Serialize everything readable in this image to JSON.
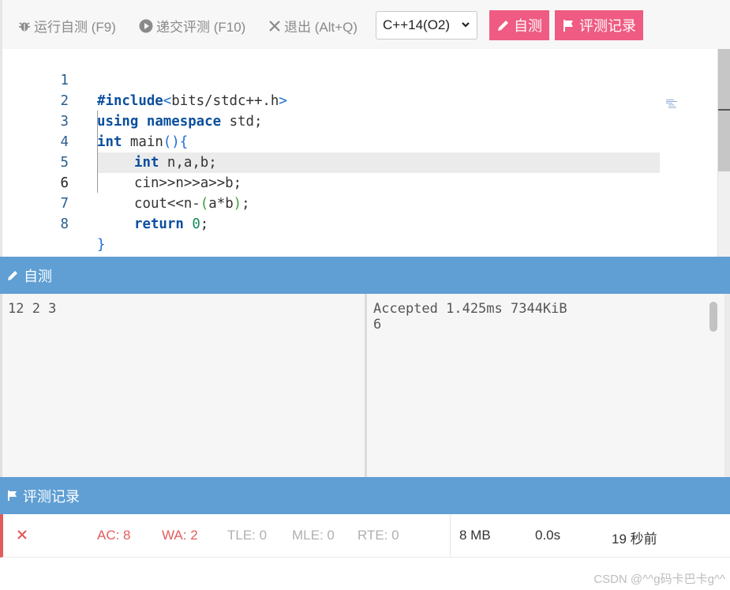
{
  "toolbar": {
    "run_label": "运行自测 (F9)",
    "submit_label": "递交评测 (F10)",
    "exit_label": "退出 (Alt+Q)",
    "language": "C++14(O2)",
    "selftest_button": "自测",
    "records_button": "评测记录"
  },
  "editor": {
    "lines": [
      {
        "n": "1"
      },
      {
        "n": "2"
      },
      {
        "n": "3"
      },
      {
        "n": "4"
      },
      {
        "n": "5"
      },
      {
        "n": "6"
      },
      {
        "n": "7"
      },
      {
        "n": "8"
      }
    ],
    "code": {
      "l1_kw": "#include",
      "l1_br1": "<",
      "l1_txt": "bits/stdc++.h",
      "l1_br2": ">",
      "l2_kw1": "using",
      "l2_kw2": "namespace",
      "l2_txt": "std;",
      "l3_kw": "int",
      "l3_txt": "main",
      "l3_br": "(){",
      "l4_kw": "int",
      "l4_txt": "n,a,b;",
      "l5_txt": "cin>>n>>a>>b;",
      "l6_txt1": "cout<<n-",
      "l6_br1": "(",
      "l6_txt2": "a*b",
      "l6_br2": ")",
      "l6_txt3": ";",
      "l7_kw": "return",
      "l7_num": "0",
      "l7_txt": ";",
      "l8_br": "}"
    },
    "current_line": 6
  },
  "selftest": {
    "title": "自测",
    "input": "12 2 3",
    "output_status": "Accepted 1.425ms 7344KiB",
    "output_value": "6"
  },
  "records": {
    "title": "评测记录",
    "row": {
      "ac": "AC: 8",
      "wa": "WA: 2",
      "tle": "TLE: 0",
      "mle": "MLE: 0",
      "rte": "RTE: 0",
      "memory": "8 MB",
      "time": "0.0s",
      "when": "19 秒前"
    }
  },
  "watermark": "CSDN @^^g码卡巴卡g^^",
  "colors": {
    "accent_pink": "#ef5b82",
    "panel_blue": "#5f9fd4",
    "error_red": "#e25c5c"
  }
}
